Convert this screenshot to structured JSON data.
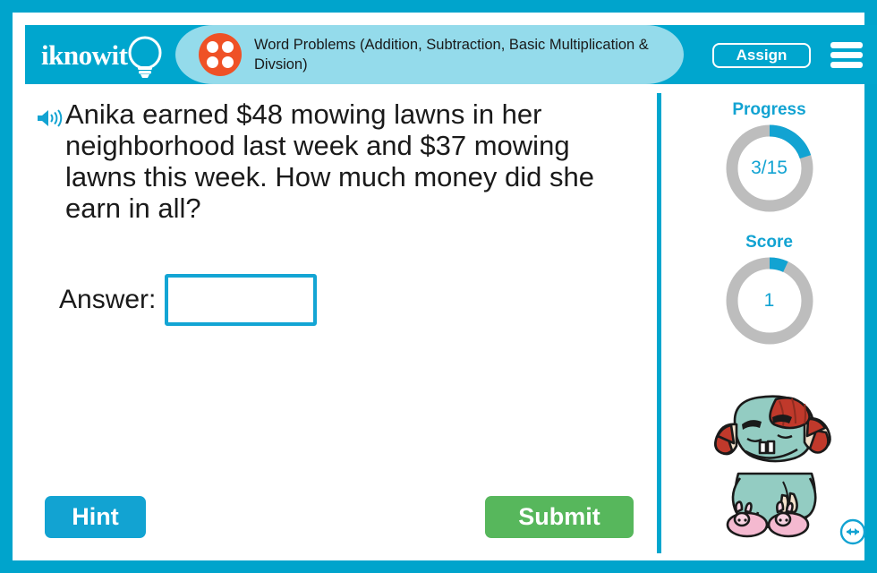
{
  "header": {
    "logo_text": "iknowit",
    "logo_icon": "lightbulb-icon",
    "dice_icon": "dice-four-icon",
    "title": "Word Problems (Addition, Subtraction, Basic Multiplication & Divsion)",
    "assign_label": "Assign",
    "menu_icon": "hamburger-menu-icon"
  },
  "question": {
    "audio_icon": "speaker-icon",
    "text": "Anika earned $48 mowing lawns in her neighborhood last week and $37 mowing lawns this week. How much money did she earn in all?"
  },
  "answer": {
    "label": "Answer:",
    "value": "",
    "placeholder": ""
  },
  "actions": {
    "hint_label": "Hint",
    "submit_label": "Submit"
  },
  "sidebar": {
    "progress": {
      "title": "Progress",
      "value": "3/15",
      "current": 3,
      "total": 15,
      "percent": 20
    },
    "score": {
      "title": "Score",
      "value": "1",
      "current": 1,
      "percent": 7
    },
    "mascot_icon": "troll-mascot-icon",
    "resize_icon": "resize-horizontal-icon"
  },
  "colors": {
    "frame_cyan": "#00a4cc",
    "header_cyan": "#00a6ce",
    "title_band_cyan": "#94dbeb",
    "accent_cyan": "#12a3d2",
    "ring_track_gray": "#bdbdbd",
    "submit_green": "#57b75c",
    "dice_orange": "#ef5126",
    "mascot_teal": "#93ccc2"
  }
}
